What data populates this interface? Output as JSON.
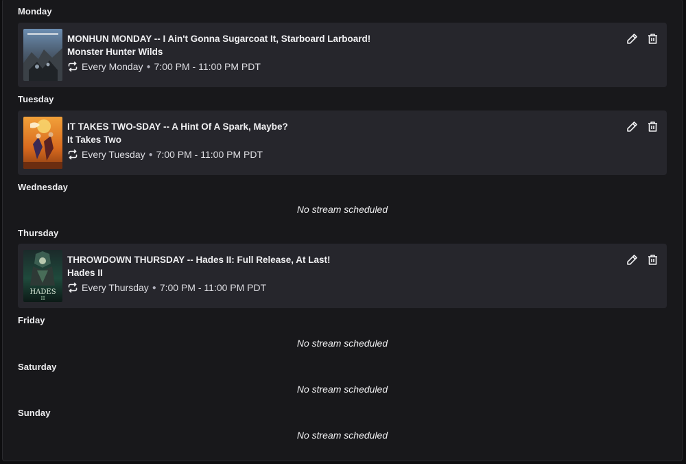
{
  "days": [
    {
      "label": "Monday",
      "stream": {
        "title": "MONHUN MONDAY -- I Ain't Gonna Sugarcoat It, Starboard Larboard!",
        "game": "Monster Hunter Wilds",
        "recurrence": "Every Monday",
        "time": "7:00 PM - 11:00 PM PDT"
      }
    },
    {
      "label": "Tuesday",
      "stream": {
        "title": "IT TAKES TWO-SDAY -- A Hint Of A Spark, Maybe?",
        "game": "It Takes Two",
        "recurrence": "Every Tuesday",
        "time": "7:00 PM - 11:00 PM PDT"
      }
    },
    {
      "label": "Wednesday",
      "empty_text": "No stream scheduled"
    },
    {
      "label": "Thursday",
      "stream": {
        "title": "THROWDOWN THURSDAY -- Hades II: Full Release, At Last!",
        "game": "Hades II",
        "recurrence": "Every Thursday",
        "time": "7:00 PM - 11:00 PM PDT"
      }
    },
    {
      "label": "Friday",
      "empty_text": "No stream scheduled"
    },
    {
      "label": "Saturday",
      "empty_text": "No stream scheduled"
    },
    {
      "label": "Sunday",
      "empty_text": "No stream scheduled"
    }
  ],
  "icons": {
    "edit": "pencil-icon",
    "delete": "trash-icon",
    "recurrence": "repeat-icon"
  },
  "colors": {
    "background": "#18181b",
    "card": "#26262c",
    "text": "#efeff1"
  }
}
